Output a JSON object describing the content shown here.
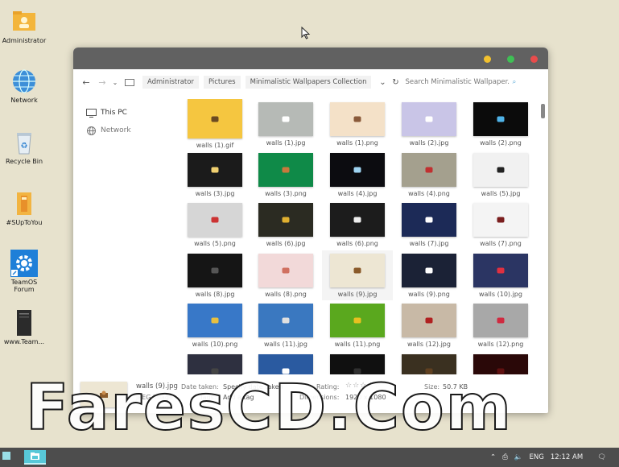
{
  "desktop": {
    "icons": [
      {
        "label": "Administrator",
        "icon": "user-folder-icon"
      },
      {
        "label": "Network",
        "icon": "globe-icon"
      },
      {
        "label": "Recycle Bin",
        "icon": "recycle-bin-icon"
      },
      {
        "label": "#SUpToYou",
        "icon": "folder-icon"
      },
      {
        "label": "TeamOS Forum",
        "icon": "gear-shortcut-icon"
      },
      {
        "label": "www.Team...",
        "icon": "shortcut-icon"
      }
    ]
  },
  "window": {
    "colors": {
      "minimize": "#f2c12e",
      "maximize": "#3fbf55",
      "close": "#e84c4c"
    },
    "breadcrumb": [
      "Administrator",
      "Pictures",
      "Minimalistic Wallpapers Collection"
    ],
    "search_placeholder": "Search Minimalistic Wallpaper...",
    "nav": {
      "this_pc": "This PC",
      "network": "Network"
    },
    "files": [
      {
        "name": "walls (1).gif",
        "bg": "#f5c640",
        "mark": "#6b4a22",
        "square": true
      },
      {
        "name": "walls (1).jpg",
        "bg": "#b6bab6",
        "mark": "#ffffff"
      },
      {
        "name": "walls (1).png",
        "bg": "#f4e1c8",
        "mark": "#8a5a3a"
      },
      {
        "name": "walls (2).jpg",
        "bg": "#c9c5e7",
        "mark": "#ffffff"
      },
      {
        "name": "walls (2).png",
        "bg": "#0b0b0b",
        "mark": "#4fb3e8"
      },
      {
        "name": "walls (3).jpg",
        "bg": "#1b1b1b",
        "mark": "#f0d070"
      },
      {
        "name": "walls (3).png",
        "bg": "#0f8a48",
        "mark": "#c8793c"
      },
      {
        "name": "walls (4).jpg",
        "bg": "#0c0c10",
        "mark": "#9fd4f2"
      },
      {
        "name": "walls (4).png",
        "bg": "#a4a08e",
        "mark": "#c03030"
      },
      {
        "name": "walls (5).jpg",
        "bg": "#f1f1f1",
        "mark": "#222222"
      },
      {
        "name": "walls (5).png",
        "bg": "#d6d6d6",
        "mark": "#cc3333"
      },
      {
        "name": "walls (6).jpg",
        "bg": "#2b2b22",
        "mark": "#e0b030"
      },
      {
        "name": "walls (6).png",
        "bg": "#1c1c1c",
        "mark": "#eeeeee"
      },
      {
        "name": "walls (7).jpg",
        "bg": "#1c2a57",
        "mark": "#ffffff"
      },
      {
        "name": "walls (7).png",
        "bg": "#f4f4f4",
        "mark": "#7a1e1e"
      },
      {
        "name": "walls (8).jpg",
        "bg": "#151515",
        "mark": "#555555"
      },
      {
        "name": "walls (8).png",
        "bg": "#f2d9d9",
        "mark": "#d07060"
      },
      {
        "name": "walls (9).jpg",
        "bg": "#ede6d3",
        "mark": "#8a5a2a",
        "selected": true
      },
      {
        "name": "walls (9).png",
        "bg": "#1b2236",
        "mark": "#ffffff"
      },
      {
        "name": "walls (10).jpg",
        "bg": "#2b3563",
        "mark": "#e03040"
      },
      {
        "name": "walls (10).png",
        "bg": "#3878c8",
        "mark": "#e8c040"
      },
      {
        "name": "walls (11).jpg",
        "bg": "#3a78c0",
        "mark": "#e0e0e0"
      },
      {
        "name": "walls (11).png",
        "bg": "#5aa81e",
        "mark": "#e8c020"
      },
      {
        "name": "walls (12).jpg",
        "bg": "#c8b9a6",
        "mark": "#b02020"
      },
      {
        "name": "walls (12).png",
        "bg": "#a8a8a8",
        "mark": "#d02a40"
      },
      {
        "name": "",
        "bg": "#2e3040",
        "mark": "#444444"
      },
      {
        "name": "",
        "bg": "#2a5aa0",
        "mark": "#ffffff"
      },
      {
        "name": "",
        "bg": "#101010",
        "mark": "#303030"
      },
      {
        "name": "",
        "bg": "#3a3020",
        "mark": "#604020"
      },
      {
        "name": "",
        "bg": "#2a0808",
        "mark": "#601010"
      }
    ],
    "details": {
      "filename": "walls (9).jpg",
      "filetype": "JPEG image",
      "date_taken_label": "Date taken:",
      "date_taken_value": "Specify date taken",
      "tags_label": "Tags:",
      "tags_value": "Add a tag",
      "rating_label": "Rating:",
      "rating_stars": "☆☆☆☆☆",
      "dimensions_label": "Dimensions:",
      "dimensions_value": "1920 x 1080",
      "size_label": "Size:",
      "size_value": "50.7 KB"
    }
  },
  "taskbar": {
    "lang": "ENG",
    "time": "12:12 AM"
  },
  "watermark": "FaresCD.Com"
}
